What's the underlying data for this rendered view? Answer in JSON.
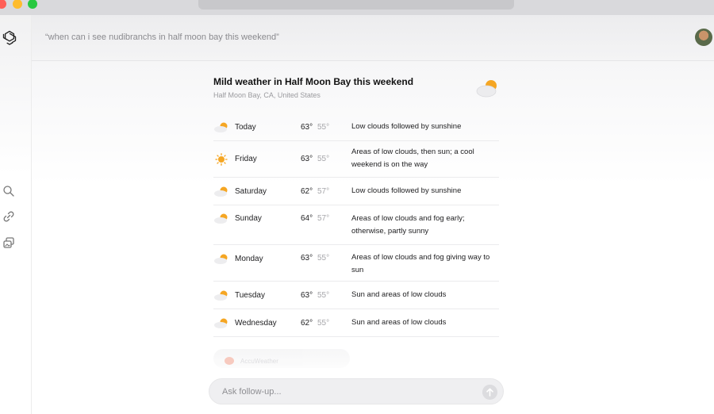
{
  "window": {
    "controls": [
      "close",
      "minimize",
      "maximize"
    ]
  },
  "header": {
    "query": "“when can i see nudibranchs in half moon bay this weekend”",
    "avatar_icon": "user-avatar"
  },
  "rail": {
    "icons": [
      "openai-logo-icon",
      "search-icon",
      "link-icon",
      "image-gallery-icon"
    ]
  },
  "weather": {
    "title": "Mild weather in Half Moon Bay this weekend",
    "location": "Half Moon Bay, CA, United States",
    "days": [
      {
        "day": "Today",
        "hi": "63°",
        "lo": "55°",
        "desc": "Low clouds followed by sunshine",
        "icon": "partly-cloudy-icon"
      },
      {
        "day": "Friday",
        "hi": "63°",
        "lo": "55°",
        "desc": "Areas of low clouds, then sun; a cool weekend is on the way",
        "icon": "sunny-icon"
      },
      {
        "day": "Saturday",
        "hi": "62°",
        "lo": "57°",
        "desc": "Low clouds followed by sunshine",
        "icon": "partly-cloudy-icon"
      },
      {
        "day": "Sunday",
        "hi": "64°",
        "lo": "57°",
        "desc": "Areas of low clouds and fog early; otherwise, partly sunny",
        "icon": "partly-cloudy-icon"
      },
      {
        "day": "Monday",
        "hi": "63°",
        "lo": "55°",
        "desc": "Areas of low clouds and fog giving way to sun",
        "icon": "partly-cloudy-icon"
      },
      {
        "day": "Tuesday",
        "hi": "63°",
        "lo": "55°",
        "desc": "Sun and areas of low clouds",
        "icon": "partly-cloudy-icon"
      },
      {
        "day": "Wednesday",
        "hi": "62°",
        "lo": "55°",
        "desc": "Sun and areas of low clouds",
        "icon": "partly-cloudy-icon"
      }
    ],
    "source": "AccuWeather"
  },
  "followup": {
    "placeholder": "Ask follow-up..."
  },
  "colors": {
    "sun": "#f5a623",
    "cloud": "#e8e8ea",
    "accent_text": "#1d1d1f"
  }
}
